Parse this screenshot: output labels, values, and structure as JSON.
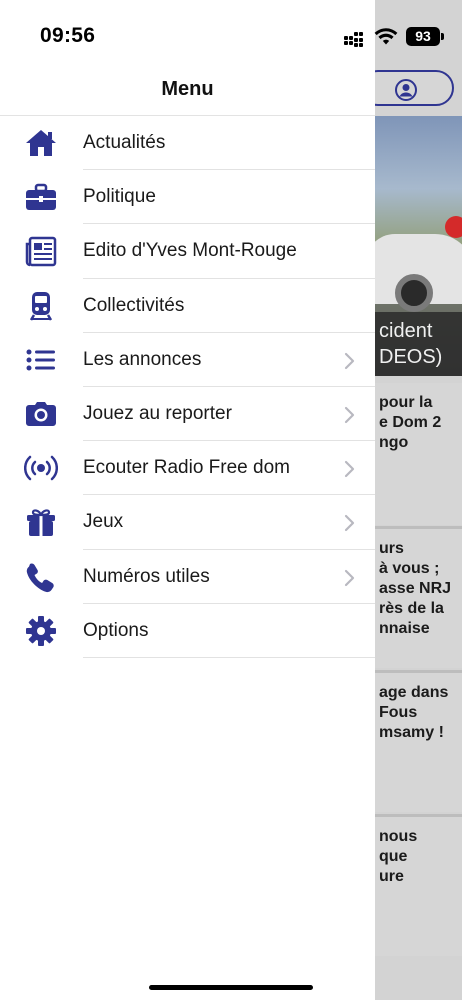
{
  "status_bar": {
    "time": "09:56",
    "battery_level": "93"
  },
  "header": {
    "title": "Menu"
  },
  "menu": {
    "items": [
      {
        "label": "Actualités",
        "icon": "home-icon",
        "has_chevron": false
      },
      {
        "label": "Politique",
        "icon": "briefcase-icon",
        "has_chevron": false
      },
      {
        "label": "Edito d'Yves Mont-Rouge",
        "icon": "newspaper-icon",
        "has_chevron": false
      },
      {
        "label": "Collectivités",
        "icon": "train-icon",
        "has_chevron": false
      },
      {
        "label": "Les annonces",
        "icon": "list-icon",
        "has_chevron": true
      },
      {
        "label": "Jouez au reporter",
        "icon": "camera-icon",
        "has_chevron": true
      },
      {
        "label": "Ecouter Radio Free dom",
        "icon": "broadcast-icon",
        "has_chevron": true
      },
      {
        "label": "Jeux",
        "icon": "gift-icon",
        "has_chevron": true
      },
      {
        "label": "Numéros utiles",
        "icon": "phone-icon",
        "has_chevron": true
      },
      {
        "label": "Options",
        "icon": "gear-icon",
        "has_chevron": false
      }
    ]
  },
  "background": {
    "hero_caption_lines": [
      "cident",
      "DEOS)"
    ],
    "articles": [
      {
        "lines": [
          "pour la",
          "e Dom 2",
          "ngo"
        ]
      },
      {
        "lines": [
          "urs",
          "à vous ;",
          "asse NRJ",
          "rès de la",
          "nnaise"
        ]
      },
      {
        "lines": [
          "age dans",
          "Fous",
          "msamy !"
        ]
      },
      {
        "lines": [
          "nous",
          "que",
          "ure"
        ]
      }
    ]
  },
  "colors": {
    "accent": "#2f3591",
    "chevron": "#b8b8c0",
    "overlay": "#d3d3d3"
  }
}
